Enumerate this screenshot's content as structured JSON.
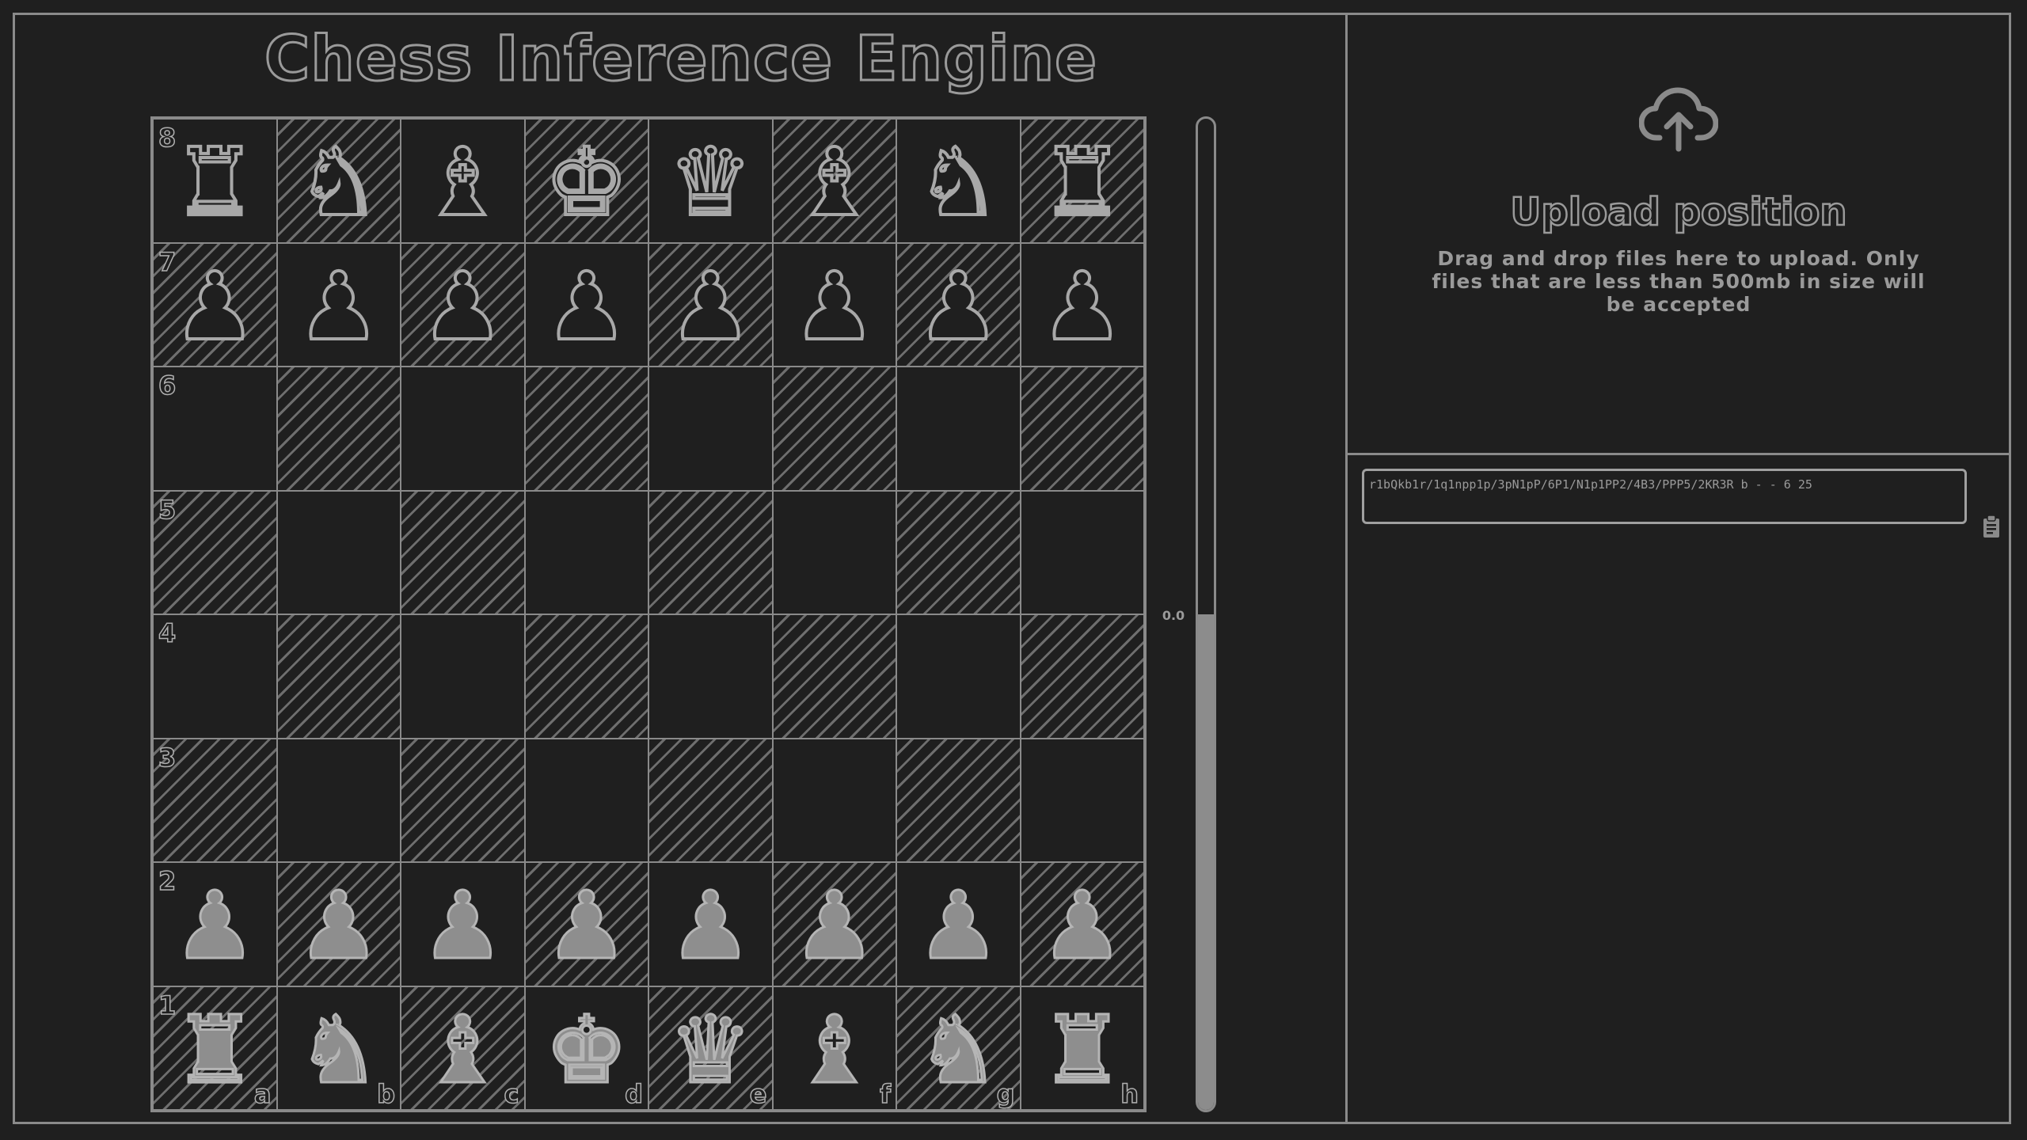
{
  "app": {
    "title": "Chess Inference Engine"
  },
  "board": {
    "ranks": [
      "8",
      "7",
      "6",
      "5",
      "4",
      "3",
      "2",
      "1"
    ],
    "files": [
      "a",
      "b",
      "c",
      "d",
      "e",
      "f",
      "g",
      "h"
    ],
    "rows": [
      [
        "♜",
        "♞",
        "♝",
        "♚",
        "♛",
        "♝",
        "♞",
        "♜"
      ],
      [
        "♟",
        "♟",
        "♟",
        "♟",
        "♟",
        "♟",
        "♟",
        "♟"
      ],
      [
        "",
        "",
        "",
        "",
        "",
        "",
        "",
        ""
      ],
      [
        "",
        "",
        "",
        "",
        "",
        "",
        "",
        ""
      ],
      [
        "",
        "",
        "",
        "",
        "",
        "",
        "",
        ""
      ],
      [
        "",
        "",
        "",
        "",
        "",
        "",
        "",
        ""
      ],
      [
        "♟",
        "♟",
        "♟",
        "♟",
        "♟",
        "♟",
        "♟",
        "♟"
      ],
      [
        "♜",
        "♞",
        "♝",
        "♚",
        "♛",
        "♝",
        "♞",
        "♜"
      ]
    ],
    "colors": [
      [
        "black",
        "black",
        "black",
        "black",
        "black",
        "black",
        "black",
        "black"
      ],
      [
        "black",
        "black",
        "black",
        "black",
        "black",
        "black",
        "black",
        "black"
      ],
      [
        "",
        "",
        "",
        "",
        "",
        "",
        "",
        ""
      ],
      [
        "",
        "",
        "",
        "",
        "",
        "",
        "",
        ""
      ],
      [
        "",
        "",
        "",
        "",
        "",
        "",
        "",
        ""
      ],
      [
        "",
        "",
        "",
        "",
        "",
        "",
        "",
        ""
      ],
      [
        "white",
        "white",
        "white",
        "white",
        "white",
        "white",
        "white",
        "white"
      ],
      [
        "white",
        "white",
        "white",
        "white",
        "white",
        "white",
        "white",
        "white"
      ]
    ]
  },
  "evaluation": {
    "value_text": "0.0",
    "white_fraction": 0.5
  },
  "upload": {
    "icon": "cloud-upload-icon",
    "title": "Upload position",
    "description": "Drag and drop files here to upload. Only files that are less than 500mb in size will be accepted"
  },
  "fen": {
    "value": "r1bQkb1r/1q1npp1p/3pN1pP/6P1/N1p1PP2/4B3/PPP5/2KR3R b - - 6 25",
    "copy_icon": "clipboard-icon"
  },
  "colors": {
    "background": "#1f1f1f",
    "line": "#8a8a8a",
    "text": "#9a9a9a"
  }
}
